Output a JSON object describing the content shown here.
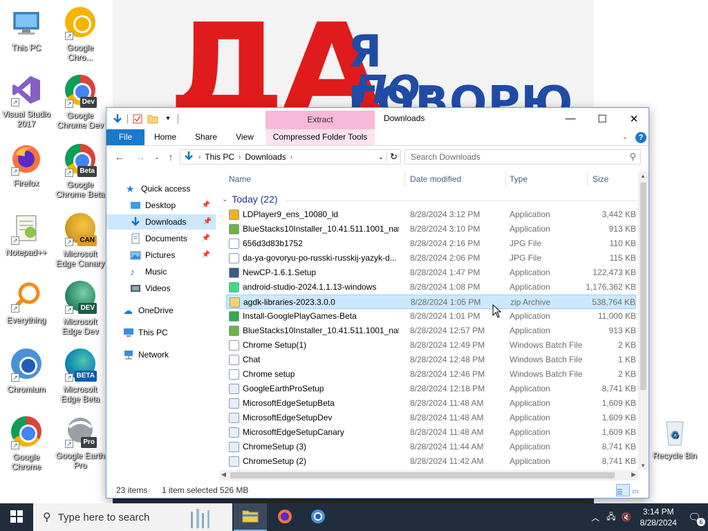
{
  "desktop": {
    "icons": [
      {
        "label": "This PC"
      },
      {
        "label": "Google Chro..."
      },
      {
        "label": "Visual Studio 2017"
      },
      {
        "label": "Google Chrome Dev",
        "badge": "Dev"
      },
      {
        "label": "Firefox"
      },
      {
        "label": "Google Chrome Beta",
        "badge": "Beta"
      },
      {
        "label": "Notepad++"
      },
      {
        "label": "Microsoft Edge Canary",
        "badge": "CAN"
      },
      {
        "label": "Everything"
      },
      {
        "label": "Microsoft Edge Dev",
        "badge": "DEV"
      },
      {
        "label": "Chromium"
      },
      {
        "label": "Microsoft Edge Beta",
        "badge": "BETA"
      },
      {
        "label": "Google Chrome"
      },
      {
        "label": "Google Earth Pro",
        "badge": "Pro"
      },
      {
        "label": "Recycle Bin"
      }
    ],
    "wallpaper_text": {
      "big": "ДА",
      "line1": "Я ГОВОРЮ",
      "line2": "ПО-РУССКИ"
    }
  },
  "window": {
    "title": "Downloads",
    "context_tab_header": "Extract",
    "ribbon_tabs": [
      "File",
      "Home",
      "Share",
      "View",
      "Compressed Folder Tools"
    ],
    "address": {
      "segments": [
        "This PC",
        "Downloads"
      ]
    },
    "search_placeholder": "Search Downloads"
  },
  "navigation": {
    "items": [
      {
        "label": "Quick access"
      },
      {
        "label": "Desktop"
      },
      {
        "label": "Downloads"
      },
      {
        "label": "Documents"
      },
      {
        "label": "Pictures"
      },
      {
        "label": "Music"
      },
      {
        "label": "Videos"
      },
      {
        "label": "OneDrive"
      },
      {
        "label": "This PC"
      },
      {
        "label": "Network"
      }
    ]
  },
  "content": {
    "columns": [
      "Name",
      "Date modified",
      "Type",
      "Size"
    ],
    "group": "Today (22)",
    "files": [
      {
        "name": "LDPlayer9_ens_10080_ld",
        "date": "8/28/2024 3:12 PM",
        "type": "Application",
        "size": "3,442 KB",
        "icon": "ldplayer-icon"
      },
      {
        "name": "BlueStacks10Installer_10.41.511.1001_nati...",
        "date": "8/28/2024 3:10 PM",
        "type": "Application",
        "size": "913 KB",
        "icon": "bluestacks-icon"
      },
      {
        "name": "656d3d83b1752",
        "date": "8/28/2024 2:16 PM",
        "type": "JPG File",
        "size": "110 KB",
        "icon": "image-file-icon"
      },
      {
        "name": "da-ya-govoryu-po-russki-russkij-yazyk-d...",
        "date": "8/28/2024 2:06 PM",
        "type": "JPG File",
        "size": "115 KB",
        "icon": "image-file-icon"
      },
      {
        "name": "NewCP-1.6.1.Setup",
        "date": "8/28/2024 1:47 PM",
        "type": "Application",
        "size": "122,473 KB",
        "icon": "setup-icon"
      },
      {
        "name": "android-studio-2024.1.1.13-windows",
        "date": "8/28/2024 1:08 PM",
        "type": "Application",
        "size": "1,176,362 KB",
        "icon": "android-icon"
      },
      {
        "name": "agdk-libraries-2023.3.0.0",
        "date": "8/28/2024 1:05 PM",
        "type": "zip Archive",
        "size": "538,764 KB",
        "icon": "zip-icon"
      },
      {
        "name": "Install-GooglePlayGames-Beta",
        "date": "8/28/2024 1:01 PM",
        "type": "Application",
        "size": "11,000 KB",
        "icon": "play-icon"
      },
      {
        "name": "BlueStacks10Installer_10.41.511.1001_nati...",
        "date": "8/28/2024 12:57 PM",
        "type": "Application",
        "size": "913 KB",
        "icon": "bluestacks-icon"
      },
      {
        "name": "Chrome Setup(1)",
        "date": "8/28/2024 12:49 PM",
        "type": "Windows Batch File",
        "size": "2 KB",
        "icon": "batch-file-icon"
      },
      {
        "name": "Chat",
        "date": "8/28/2024 12:48 PM",
        "type": "Windows Batch File",
        "size": "1 KB",
        "icon": "batch-file-icon"
      },
      {
        "name": "Chrome setup",
        "date": "8/28/2024 12:46 PM",
        "type": "Windows Batch File",
        "size": "2 KB",
        "icon": "batch-file-icon"
      },
      {
        "name": "GoogleEarthProSetup",
        "date": "8/28/2024 12:18 PM",
        "type": "Application",
        "size": "8,741 KB",
        "icon": "installer-icon"
      },
      {
        "name": "MicrosoftEdgeSetupBeta",
        "date": "8/28/2024 11:48 AM",
        "type": "Application",
        "size": "1,609 KB",
        "icon": "installer-icon"
      },
      {
        "name": "MicrosoftEdgeSetupDev",
        "date": "8/28/2024 11:48 AM",
        "type": "Application",
        "size": "1,609 KB",
        "icon": "installer-icon"
      },
      {
        "name": "MicrosoftEdgeSetupCanary",
        "date": "8/28/2024 11:48 AM",
        "type": "Application",
        "size": "1,609 KB",
        "icon": "installer-icon"
      },
      {
        "name": "ChromeSetup (3)",
        "date": "8/28/2024 11:44 AM",
        "type": "Application",
        "size": "8,741 KB",
        "icon": "installer-icon"
      },
      {
        "name": "ChromeSetup (2)",
        "date": "8/28/2024 11:42 AM",
        "type": "Application",
        "size": "8,741 KB",
        "icon": "installer-icon"
      }
    ],
    "selected_index": 6
  },
  "status": {
    "items": "23 items",
    "selection": "1 item selected",
    "size": "526 MB"
  },
  "taskbar": {
    "search_placeholder": "Type here to search",
    "time": "3:14 PM",
    "date": "8/28/2024",
    "notification_count": "6"
  },
  "colors": {
    "accent": "#1979ca",
    "selection": "#cce8ff",
    "context_tab": "#f7b9d7",
    "group_header": "#1e3287",
    "taskbar": "#1f2d3d"
  }
}
